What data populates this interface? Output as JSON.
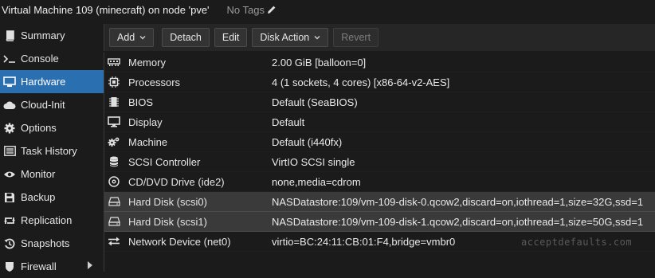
{
  "header": {
    "title": "Virtual Machine 109 (minecraft) on node 'pve'",
    "tags": "No Tags",
    "edit_icon": "pencil-icon"
  },
  "sidebar": {
    "items": [
      {
        "label": "Summary",
        "icon": "book-icon"
      },
      {
        "label": "Console",
        "icon": "terminal-icon"
      },
      {
        "label": "Hardware",
        "icon": "monitor-icon",
        "active": true
      },
      {
        "label": "Cloud-Init",
        "icon": "cloud-icon"
      },
      {
        "label": "Options",
        "icon": "gear-icon"
      },
      {
        "label": "Task History",
        "icon": "list-icon"
      },
      {
        "label": "Monitor",
        "icon": "eye-icon"
      },
      {
        "label": "Backup",
        "icon": "floppy-icon"
      },
      {
        "label": "Replication",
        "icon": "retweet-icon"
      },
      {
        "label": "Snapshots",
        "icon": "history-icon"
      },
      {
        "label": "Firewall",
        "icon": "shield-icon"
      }
    ]
  },
  "toolbar": {
    "add_label": "Add",
    "detach_label": "Detach",
    "edit_label": "Edit",
    "disk_action_label": "Disk Action",
    "revert_label": "Revert"
  },
  "hardware": {
    "rows": [
      {
        "name": "Memory",
        "value": "2.00 GiB [balloon=0]",
        "icon": "memory-icon"
      },
      {
        "name": "Processors",
        "value": "4 (1 sockets, 4 cores) [x86-64-v2-AES]",
        "icon": "cpu-icon"
      },
      {
        "name": "BIOS",
        "value": "Default (SeaBIOS)",
        "icon": "microchip-icon"
      },
      {
        "name": "Display",
        "value": "Default",
        "icon": "desktop-icon"
      },
      {
        "name": "Machine",
        "value": "Default (i440fx)",
        "icon": "cogs-icon"
      },
      {
        "name": "SCSI Controller",
        "value": "VirtIO SCSI single",
        "icon": "database-icon"
      },
      {
        "name": "CD/DVD Drive (ide2)",
        "value": "none,media=cdrom",
        "icon": "cdrom-icon"
      },
      {
        "name": "Hard Disk (scsi0)",
        "value": "NASDatastore:109/vm-109-disk-0.qcow2,discard=on,iothread=1,size=32G,ssd=1",
        "icon": "hdd-icon",
        "selected": true
      },
      {
        "name": "Hard Disk (scsi1)",
        "value": "NASDatastore:109/vm-109-disk-1.qcow2,discard=on,iothread=1,size=50G,ssd=1",
        "icon": "hdd-icon",
        "selected": true
      },
      {
        "name": "Network Device (net0)",
        "value": "virtio=BC:24:11:CB:01:F4,bridge=vmbr0",
        "icon": "exchange-icon"
      }
    ]
  },
  "watermark": "acceptdefaults.com"
}
